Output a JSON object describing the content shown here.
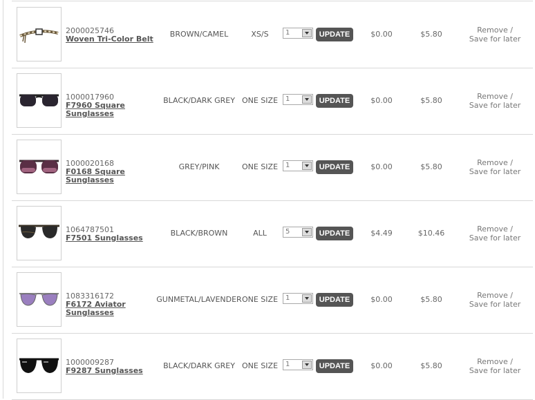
{
  "cart": {
    "update_label": "UPDATE",
    "remove_label": "Remove /",
    "save_label": "Save for later",
    "items": [
      {
        "sku": "2000025746",
        "name": "Woven Tri-Color Belt",
        "color": "BROWN/CAMEL",
        "size": "XS/S",
        "qty": "1",
        "discount": "$0.00",
        "price": "$5.80"
      },
      {
        "sku": "1000017960",
        "name": "F7960 Square Sunglasses",
        "color": "BLACK/DARK GREY",
        "size": "ONE SIZE",
        "qty": "1",
        "discount": "$0.00",
        "price": "$5.80"
      },
      {
        "sku": "1000020168",
        "name": "F0168 Square Sunglasses",
        "color": "GREY/PINK",
        "size": "ONE SIZE",
        "qty": "1",
        "discount": "$0.00",
        "price": "$5.80"
      },
      {
        "sku": "1064787501",
        "name": "F7501 Sunglasses",
        "color": "BLACK/BROWN",
        "size": "ALL",
        "qty": "5",
        "discount": "$4.49",
        "price": "$10.46"
      },
      {
        "sku": "1083316172",
        "name": "F6172 Aviator Sunglasses",
        "color": "GUNMETAL/LAVENDER",
        "size": "ONE SIZE",
        "qty": "1",
        "discount": "$0.00",
        "price": "$5.80"
      },
      {
        "sku": "1000009287",
        "name": "F9287 Sunglasses",
        "color": "BLACK/DARK GREY",
        "size": "ONE SIZE",
        "qty": "1",
        "discount": "$0.00",
        "price": "$5.80"
      }
    ]
  }
}
